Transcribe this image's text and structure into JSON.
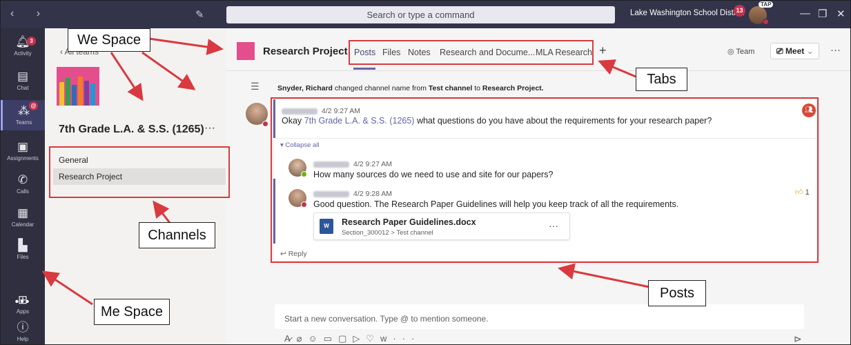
{
  "titlebar": {
    "search_placeholder": "Search or type a command",
    "org_name": "Lake Washington School District",
    "notification_count": "13",
    "me_initials": "TAP"
  },
  "rail": {
    "items": [
      {
        "label": "Activity",
        "icon": "bell-icon",
        "badge": "3"
      },
      {
        "label": "Chat",
        "icon": "chat-icon"
      },
      {
        "label": "Teams",
        "icon": "teams-icon",
        "badge": "@"
      },
      {
        "label": "Assignments",
        "icon": "assignments-icon"
      },
      {
        "label": "Calls",
        "icon": "phone-icon"
      },
      {
        "label": "Calendar",
        "icon": "calendar-icon"
      },
      {
        "label": "Files",
        "icon": "files-icon"
      },
      {
        "label": "Apps",
        "icon": "apps-icon"
      },
      {
        "label": "Help",
        "icon": "help-icon"
      }
    ]
  },
  "panel": {
    "back_label": "All teams",
    "team_name": "7th Grade L.A. & S.S. (1265)",
    "channels": [
      "General",
      "Research Project"
    ]
  },
  "channel": {
    "title": "Research Project",
    "tabs": [
      "Posts",
      "Files",
      "Notes",
      "Research and Docume...",
      "MLA Research"
    ],
    "team_label": "Team",
    "meet_label": "Meet"
  },
  "system_message": {
    "actor": "Snyder, Richard",
    "text_1": " changed channel name from ",
    "old_name": "Test channel",
    "text_2": " to ",
    "new_name": "Research Project."
  },
  "posts": {
    "root": {
      "time": "4/2 9:27 AM",
      "mention": "7th Grade L.A. & S.S. (1265)",
      "pre": "Okay ",
      "post": " what questions do you have about the requirements for your research paper?"
    },
    "collapse_label": "Collapse all",
    "replies": [
      {
        "time": "4/2 9:27 AM",
        "text": "How many sources do we need to use and site for our papers?"
      },
      {
        "time": "4/2 9:28 AM",
        "text": "Good question. The Research Paper Guidelines will help you keep track of all the requirements.",
        "likes": "1"
      }
    ],
    "attachment": {
      "name": "Research Paper Guidelines.docx",
      "path": "Section_300012 > Test channel",
      "type": "W"
    },
    "reply_label": "Reply"
  },
  "composer": {
    "placeholder": "Start a new conversation. Type @ to mention someone."
  },
  "annotations": {
    "we_space": "We Space",
    "tabs": "Tabs",
    "channels": "Channels",
    "me_space": "Me Space",
    "posts": "Posts"
  },
  "colors": {
    "titlebar": "#33344a",
    "rail": "#2f2f3f",
    "accent": "#6264a7",
    "annotation_red": "#d9393f",
    "team_tile": "#e54e8c"
  }
}
